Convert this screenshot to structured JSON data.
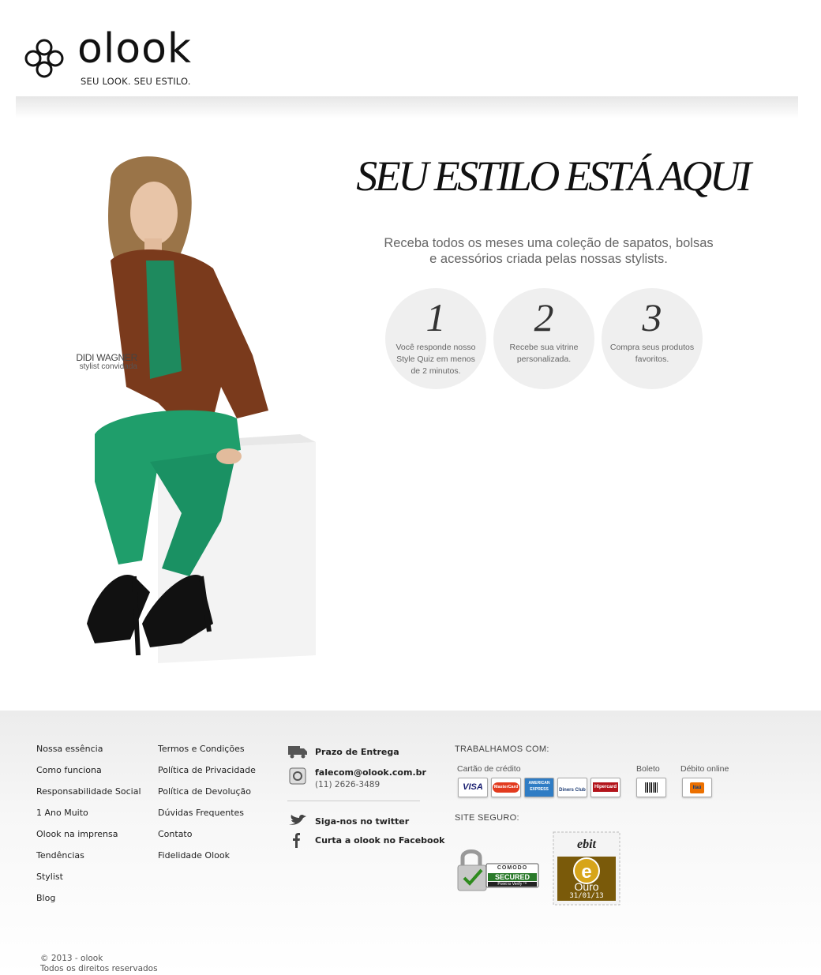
{
  "brand": {
    "name": "olook",
    "tagline": "SEU LOOK. SEU ESTILO."
  },
  "hero": {
    "title": "SEU ESTILO ESTÁ AQUI",
    "description_line1": "Receba todos os meses uma coleção de sapatos, bolsas",
    "description_line2": "e acessórios criada pelas nossas stylists.",
    "model_name": "DIDI WAGNER",
    "model_role": "stylist convidada"
  },
  "steps": [
    {
      "number": "1",
      "text": "Você responde nosso Style Quiz em menos de 2 minutos."
    },
    {
      "number": "2",
      "text": "Recebe sua vitrine personalizada."
    },
    {
      "number": "3",
      "text": "Compra seus produtos favoritos."
    }
  ],
  "footer": {
    "col1": [
      "Nossa essência",
      "Como funciona",
      "Responsabilidade Social",
      "1 Ano Muito",
      "Olook na imprensa",
      "Tendências",
      "Stylist",
      "Blog"
    ],
    "col2": [
      "Termos e Condições",
      "Política de Privacidade",
      "Política de Devolução",
      "Dúvidas Frequentes",
      "Contato",
      "Fidelidade Olook"
    ],
    "contact": {
      "delivery": "Prazo de Entrega",
      "email": "falecom@olook.com.br",
      "phone": "(11) 2626-3489",
      "twitter": "Siga-nos no twitter",
      "facebook": "Curta a olook no Facebook"
    },
    "payments_title": "TRABALHAMOS COM:",
    "credit_label": "Cartão de crédito",
    "boleto_label": "Boleto",
    "debit_label": "Débito online",
    "cards": [
      "VISA",
      "MasterCard",
      "AMERICAN EXPRESS",
      "Diners Club",
      "Hipercard"
    ],
    "debit_bank": "Itaú",
    "secure_title": "SITE SEGURO:",
    "comodo_brand": "COMODO",
    "comodo_secured": "SECURED",
    "comodo_tagline": "Point to Verify ™",
    "ebit_brand": "ebit",
    "ebit_level": "Ouro",
    "ebit_date": "31/01/13",
    "copyright_line1": "© 2013 - olook",
    "copyright_line2": "Todos os direitos reservados"
  },
  "colors": {
    "step_bg": "#efefef",
    "footer_bg": "#ececec",
    "text_dark": "#111111"
  }
}
